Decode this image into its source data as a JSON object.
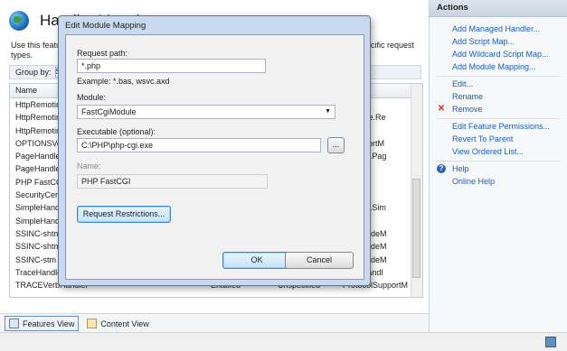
{
  "page": {
    "title": "Handler Mappings",
    "description_left": "Use this featu",
    "description_left2": "types.",
    "description_right": "pecific request",
    "group_by_label": "Group by:",
    "group_by_value": "S"
  },
  "grid": {
    "headers": [
      "Name",
      "",
      "",
      "",
      ""
    ],
    "rows": [
      [
        "HttpRemotin",
        "",
        "",
        "",
        "Module"
      ],
      [
        "HttpRemotin",
        "",
        "",
        "",
        "Runtime.Re"
      ],
      [
        "HttpRemotin",
        "",
        "",
        "",
        "Module"
      ],
      [
        "OPTIONSVerl",
        "",
        "",
        "",
        "olSupportM"
      ],
      [
        "PageHandler",
        "",
        "",
        "",
        "Web.UI.Pag"
      ],
      [
        "PageHandler",
        "",
        "",
        "",
        "Module"
      ],
      [
        "PHP FastCGI",
        "",
        "",
        "",
        "Module"
      ],
      [
        "SecurityCerti",
        "",
        "",
        "",
        "Module"
      ],
      [
        "SimpleHandl",
        "",
        "",
        "",
        "Web.UI.Sim"
      ],
      [
        "SimpleHandl",
        "",
        "",
        "",
        "Module"
      ],
      [
        "SSINC-shtm",
        "",
        "",
        "",
        "ideIncludeM"
      ],
      [
        "SSINC-shtml",
        "",
        "",
        "",
        "ideIncludeM"
      ],
      [
        "SSINC-stm",
        "",
        "",
        "",
        "ideIncludeM"
      ],
      [
        "TraceHandler",
        "",
        "",
        "",
        "Web.Handl"
      ],
      [
        "TRACEVerbHandler",
        "*",
        "Enabled",
        "Unspecified",
        "ProtocolSupportM"
      ]
    ]
  },
  "bottom_tabs": {
    "features_view": "Features View",
    "content_view": "Content View"
  },
  "actions": {
    "header": "Actions",
    "items": [
      "Add Managed Handler...",
      "Add Script Map...",
      "Add Wildcard Script Map...",
      "Add Module Mapping...",
      "Edit...",
      "Rename",
      "Remove",
      "Edit Feature Permissions...",
      "Revert To Parent",
      "View Ordered List...",
      "Help",
      "Online Help"
    ]
  },
  "dialog": {
    "title": "Edit Module Mapping",
    "request_path_label": "Request path:",
    "request_path_value": "*.php",
    "example": "Example: *.bas, wsvc.axd",
    "module_label": "Module:",
    "module_value": "FastCgiModule",
    "executable_label": "Executable (optional):",
    "executable_value": "C:\\PHP\\php-cgi.exe",
    "browse_label": "...",
    "name_label": "Name:",
    "name_value": "PHP FastCGI",
    "restrictions_button": "Request Restrictions...",
    "ok": "OK",
    "cancel": "Cancel"
  }
}
